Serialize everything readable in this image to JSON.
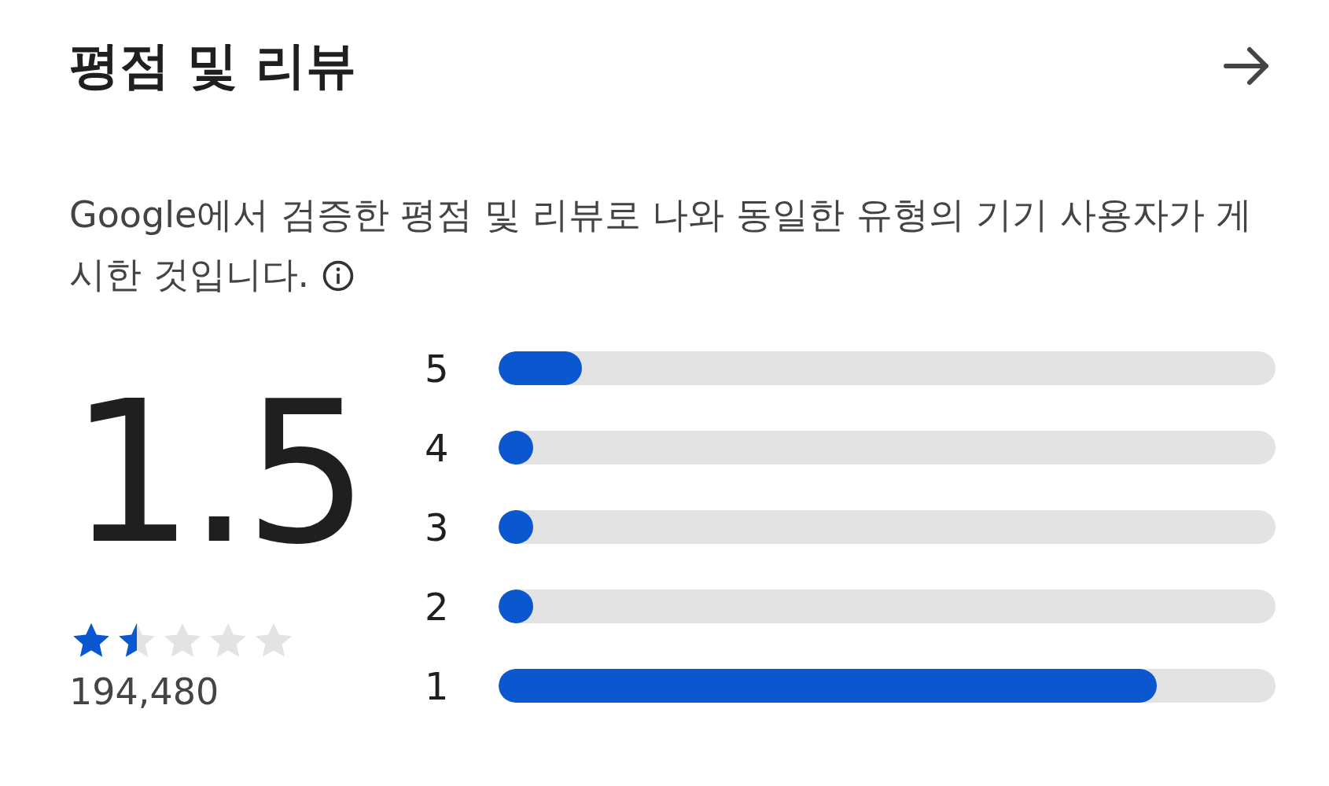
{
  "header": {
    "title": "평점 및 리뷰"
  },
  "description": "Google에서 검증한 평점 및 리뷰로 나와 동일한 유형의 기기 사용자가 게시한 것입니다.",
  "summary": {
    "score": "1.5",
    "stars": 1.5,
    "count": "194,480"
  },
  "distribution": [
    {
      "label": "5",
      "level": 0.107
    },
    {
      "label": "4",
      "level": 0.045
    },
    {
      "label": "3",
      "level": 0.045
    },
    {
      "label": "2",
      "level": 0.045
    },
    {
      "label": "1",
      "level": 0.847
    }
  ]
}
